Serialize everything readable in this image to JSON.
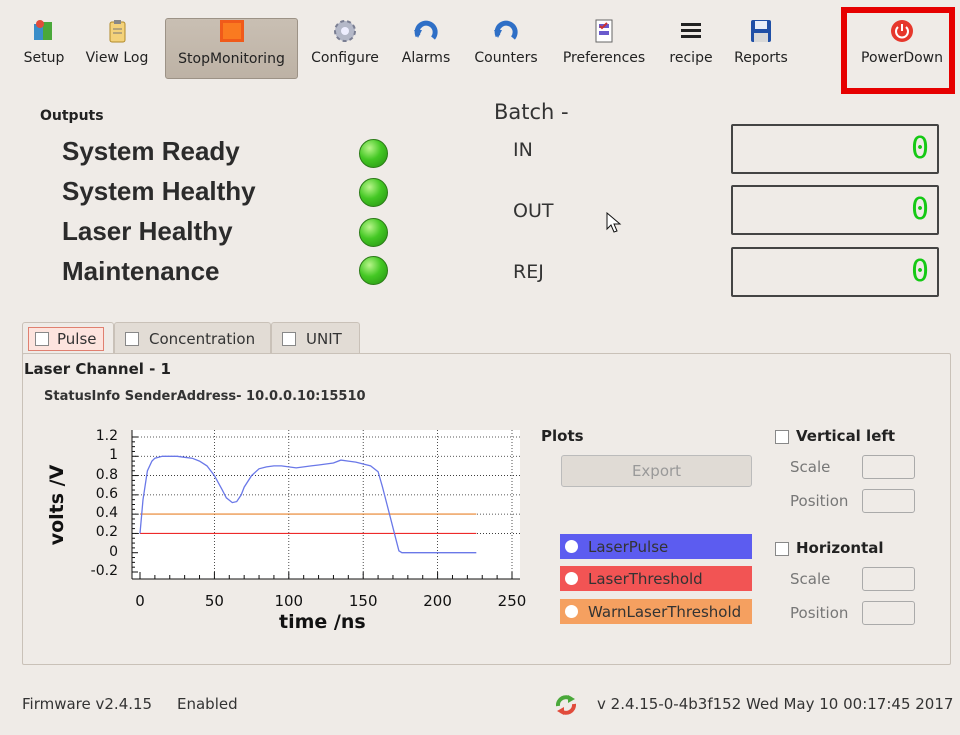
{
  "toolbar": {
    "setup": "Setup",
    "view_log": "View Log",
    "stop_monitoring": "StopMonitoring",
    "configure": "Configure",
    "alarms": "Alarms",
    "counters": "Counters",
    "preferences": "Preferences",
    "recipe": "recipe",
    "reports": "Reports",
    "power_down": "PowerDown"
  },
  "outputs": {
    "title": "Outputs",
    "items": [
      "System Ready",
      "System Healthy",
      "Laser Healthy",
      "Maintenance"
    ]
  },
  "batch": {
    "title": "Batch -",
    "labels": [
      "IN",
      "OUT",
      "REJ"
    ],
    "counts": [
      "0",
      "0",
      "0"
    ]
  },
  "tabs": [
    "Pulse",
    "Concentration",
    "UNIT"
  ],
  "panel": {
    "channel": "Laser Channel - 1",
    "status_info": "StatusInfo SenderAddress- 10.0.0.10:15510"
  },
  "chart_data": {
    "type": "line",
    "xlabel": "time /ns",
    "ylabel": "volts /V",
    "xlim": [
      0,
      250
    ],
    "ylim": [
      -0.2,
      1.2
    ],
    "x_ticks": [
      "0",
      "50",
      "100",
      "150",
      "200",
      "250"
    ],
    "y_ticks": [
      "1.2",
      "1",
      "0.8",
      "0.6",
      "0.4",
      "0.2",
      "0",
      "-0.2"
    ],
    "grid": true,
    "series": [
      {
        "name": "LaserPulse",
        "color": "#6a78e8",
        "x": [
          0,
          2,
          5,
          8,
          10,
          15,
          20,
          25,
          30,
          35,
          40,
          45,
          50,
          55,
          58,
          62,
          65,
          68,
          70,
          75,
          80,
          85,
          90,
          95,
          100,
          105,
          110,
          115,
          120,
          125,
          130,
          135,
          140,
          145,
          150,
          155,
          160,
          163,
          166,
          169,
          172,
          174,
          176,
          178,
          180,
          190,
          200,
          210,
          220,
          226
        ],
        "y": [
          0.2,
          0.55,
          0.85,
          0.95,
          0.98,
          1.0,
          1.0,
          1.0,
          0.99,
          0.98,
          0.95,
          0.9,
          0.8,
          0.66,
          0.57,
          0.52,
          0.53,
          0.6,
          0.68,
          0.8,
          0.87,
          0.89,
          0.9,
          0.9,
          0.89,
          0.88,
          0.89,
          0.9,
          0.91,
          0.92,
          0.93,
          0.96,
          0.95,
          0.94,
          0.92,
          0.9,
          0.84,
          0.68,
          0.5,
          0.32,
          0.14,
          0.02,
          0.0,
          0.0,
          0.0,
          0.0,
          0.0,
          0.0,
          0.0,
          0.0
        ]
      },
      {
        "name": "LaserThreshold",
        "color": "#ee2a2a",
        "x": [
          0,
          226
        ],
        "y": [
          0.2,
          0.2
        ]
      },
      {
        "name": "WarnLaserThreshold",
        "color": "#e8822a",
        "x": [
          0,
          226
        ],
        "y": [
          0.4,
          0.4
        ]
      }
    ]
  },
  "plots": {
    "title": "Plots",
    "export": "Export",
    "legend": [
      {
        "label": "LaserPulse",
        "color": "#5c5cf0"
      },
      {
        "label": "LaserThreshold",
        "color": "#f25454"
      },
      {
        "label": "WarnLaserThreshold",
        "color": "#f5a060"
      }
    ]
  },
  "vertical": {
    "title": "Vertical left",
    "scale": "Scale",
    "position": "Position"
  },
  "horizontal": {
    "title": "Horizontal",
    "scale": "Scale",
    "position": "Position"
  },
  "statusbar": {
    "firmware": "Firmware v2.4.15",
    "enabled": "Enabled",
    "version_time": "v 2.4.15-0-4b3f152  Wed May 10 00:17:45 2017"
  }
}
